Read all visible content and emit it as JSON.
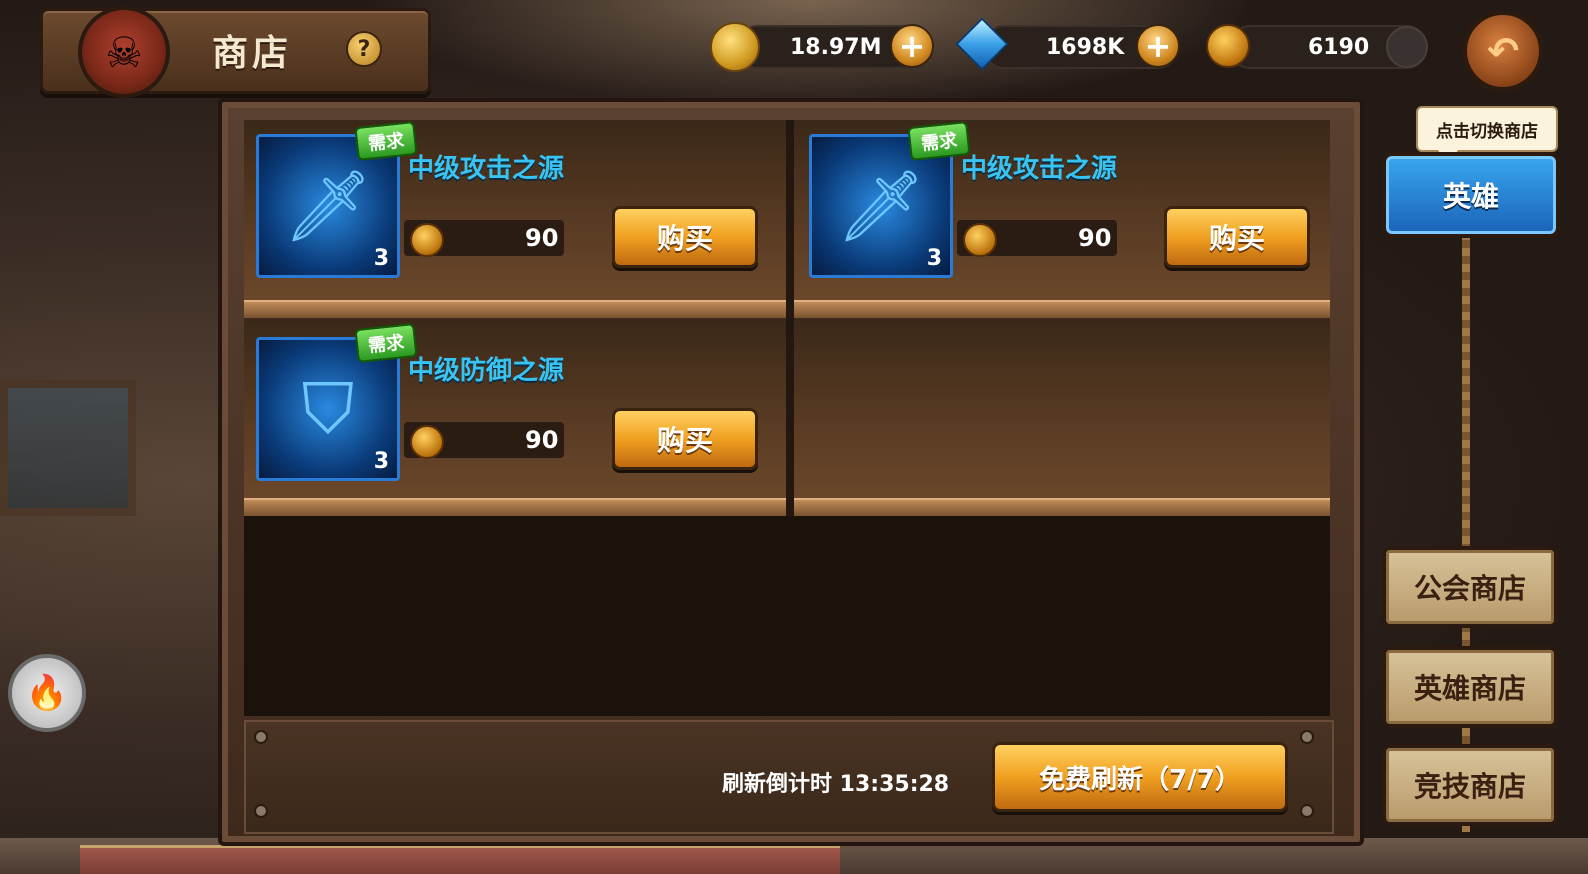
{
  "header": {
    "title": "商店",
    "help_glyph": "?"
  },
  "currencies": {
    "gold": {
      "icon": "gold-coin-icon",
      "value": "18.97M"
    },
    "gems": {
      "icon": "diamond-icon",
      "value": "1698K"
    },
    "medals": {
      "icon": "medal-icon",
      "value": "6190"
    }
  },
  "back_glyph": "↶",
  "items": [
    {
      "name": "中级攻击之源",
      "badge": "需求",
      "count": "3",
      "icon": "sword-icon",
      "price": "90",
      "buy_label": "购买"
    },
    {
      "name": "中级攻击之源",
      "badge": "需求",
      "count": "3",
      "icon": "sword-icon",
      "price": "90",
      "buy_label": "购买"
    },
    {
      "name": "中级防御之源",
      "badge": "需求",
      "count": "3",
      "icon": "shield-icon",
      "price": "90",
      "buy_label": "购买"
    }
  ],
  "footer": {
    "countdown": "刷新倒计时 13:35:28",
    "refresh_label": "免费刷新（7/7）"
  },
  "side": {
    "tooltip": "点击切换商店",
    "hero_toggle": "英雄",
    "tabs": [
      "公会商店",
      "英雄商店",
      "竞技商店"
    ]
  },
  "colors": {
    "item_name": "#38c4f2",
    "buy_button": "#f0a020",
    "hero_toggle": "#3aa8f0"
  }
}
